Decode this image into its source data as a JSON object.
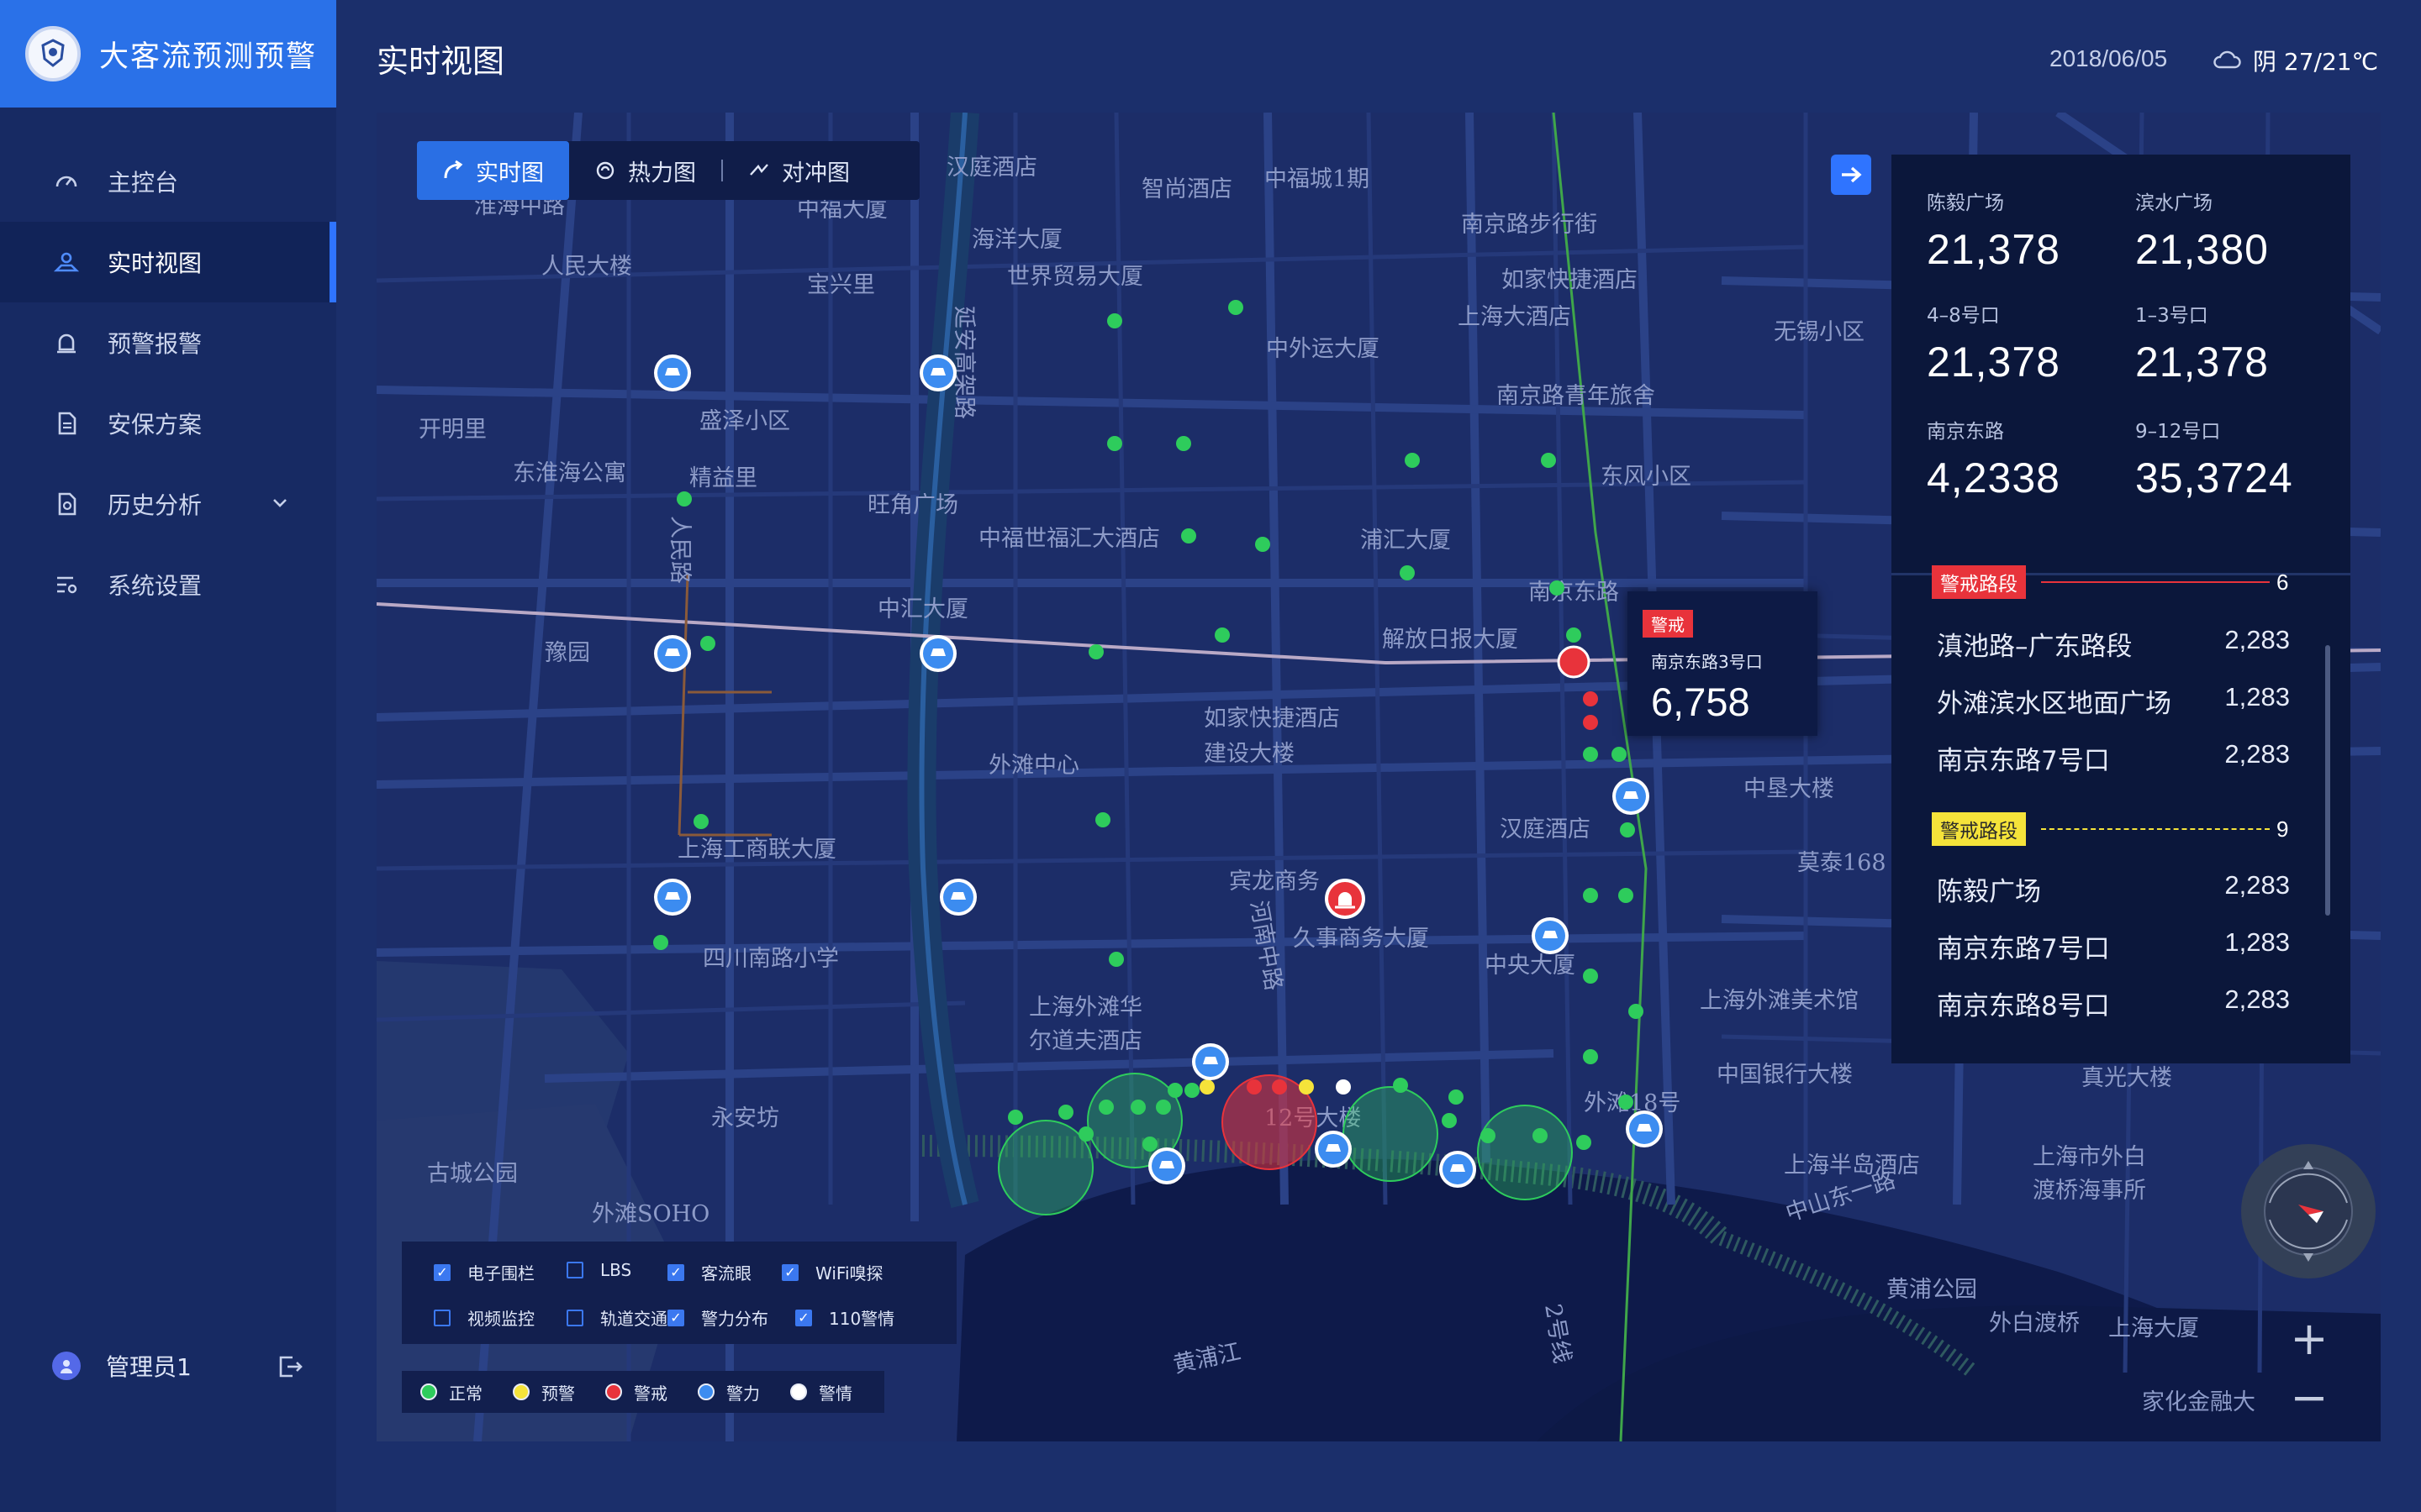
{
  "brand": {
    "title": "大客流预测预警",
    "logo_icon": "police-badge-icon"
  },
  "nav": [
    {
      "label": "主控台",
      "icon": "dashboard-icon"
    },
    {
      "label": "实时视图",
      "icon": "map-pin-icon",
      "active": true
    },
    {
      "label": "预警报警",
      "icon": "alarm-icon"
    },
    {
      "label": "安保方案",
      "icon": "document-icon"
    },
    {
      "label": "历史分析",
      "icon": "history-doc-icon",
      "expandable": true
    },
    {
      "label": "系统设置",
      "icon": "settings-list-icon"
    }
  ],
  "user": {
    "name": "管理员1"
  },
  "header": {
    "title": "实时视图",
    "date": "2018/06/05",
    "weather": "阴 27/21℃"
  },
  "view_switch": [
    {
      "label": "实时图",
      "active": true
    },
    {
      "label": "热力图"
    },
    {
      "label": "对冲图"
    }
  ],
  "stats": [
    {
      "label": "陈毅广场",
      "value": "21,378"
    },
    {
      "label": "滨水广场",
      "value": "21,380"
    },
    {
      "label": "4–8号口",
      "value": "21,378"
    },
    {
      "label": "1–3号口",
      "value": "21,378"
    },
    {
      "label": "南京东路",
      "value": "4,2338"
    },
    {
      "label": "9–12号口",
      "value": "35,3724"
    }
  ],
  "segments": [
    {
      "badge": "警戒路段",
      "color": "red",
      "count": "6",
      "rows": [
        {
          "name": "滇池路–广东路段",
          "value": "2,283"
        },
        {
          "name": "外滩滨水区地面广场",
          "value": "1,283"
        },
        {
          "name": "南京东路7号口",
          "value": "2,283"
        }
      ]
    },
    {
      "badge": "警戒路段",
      "color": "yellow",
      "count": "9",
      "rows": [
        {
          "name": "陈毅广场",
          "value": "2,283"
        },
        {
          "name": "南京东路7号口",
          "value": "1,283"
        },
        {
          "name": "南京东路8号口",
          "value": "2,283"
        }
      ]
    }
  ],
  "alert": {
    "tag": "警戒",
    "location": "南京东路3号口",
    "value": "6,758"
  },
  "layers": [
    {
      "label": "电子围栏",
      "checked": true
    },
    {
      "label": "LBS",
      "checked": false
    },
    {
      "label": "客流眼",
      "checked": true
    },
    {
      "label": "WiFi嗅探",
      "checked": true
    },
    {
      "label": "视频监控",
      "checked": false
    },
    {
      "label": "轨道交通",
      "checked": false
    },
    {
      "label": "警力分布",
      "checked": true
    },
    {
      "label": "110警情",
      "checked": true
    }
  ],
  "legend": [
    {
      "label": "正常",
      "color": "#2ecc5c"
    },
    {
      "label": "预警",
      "color": "#f5e33a"
    },
    {
      "label": "警戒",
      "color": "#e8333b"
    },
    {
      "label": "警力",
      "color": "#3c8cf0"
    },
    {
      "label": "警情",
      "color": "#ffffff"
    }
  ],
  "zoom": {
    "in": "+",
    "out": "−"
  },
  "map_labels": [
    "淮海中路",
    "中福大厦",
    "汉庭酒店",
    "智尚酒店",
    "中福城1期",
    "南京路步行街",
    "海洋大厦",
    "世界贸易大厦",
    "宝兴里",
    "如家快捷酒店",
    "上海大酒店",
    "人民大楼",
    "中外运大厦",
    "无锡小区",
    "南京路青年旅舍",
    "开明里",
    "盛泽小区",
    "东淮海公寓",
    "精益里",
    "旺角广场",
    "东风小区",
    "中福世福汇大酒店",
    "浦汇大厦",
    "南京东路",
    "中汇大厦",
    "解放日报大厦",
    "豫园",
    "如家快捷酒店",
    "建设大楼",
    "外滩中心",
    "中垦大楼",
    "汉庭酒店",
    "上海工商联大厦",
    "宾龙商务",
    "久事商务大厦",
    "莫泰168",
    "四川南路小学",
    "中央大厦",
    "上海外滩华",
    "尔道夫酒店",
    "上海外滩美术馆",
    "中国银行大楼",
    "永安坊",
    "12号大楼",
    "外滩18号",
    "真光大楼",
    "古城公园",
    "外滩SOHO",
    "上海半岛酒店",
    "上海市外白",
    "渡桥海事所",
    "黄浦公园",
    "外白渡桥",
    "上海大厦",
    "家化金融大",
    "黄浦江",
    "延安高架路",
    "人民路",
    "河南中路",
    "中山东一路",
    "2号线"
  ]
}
